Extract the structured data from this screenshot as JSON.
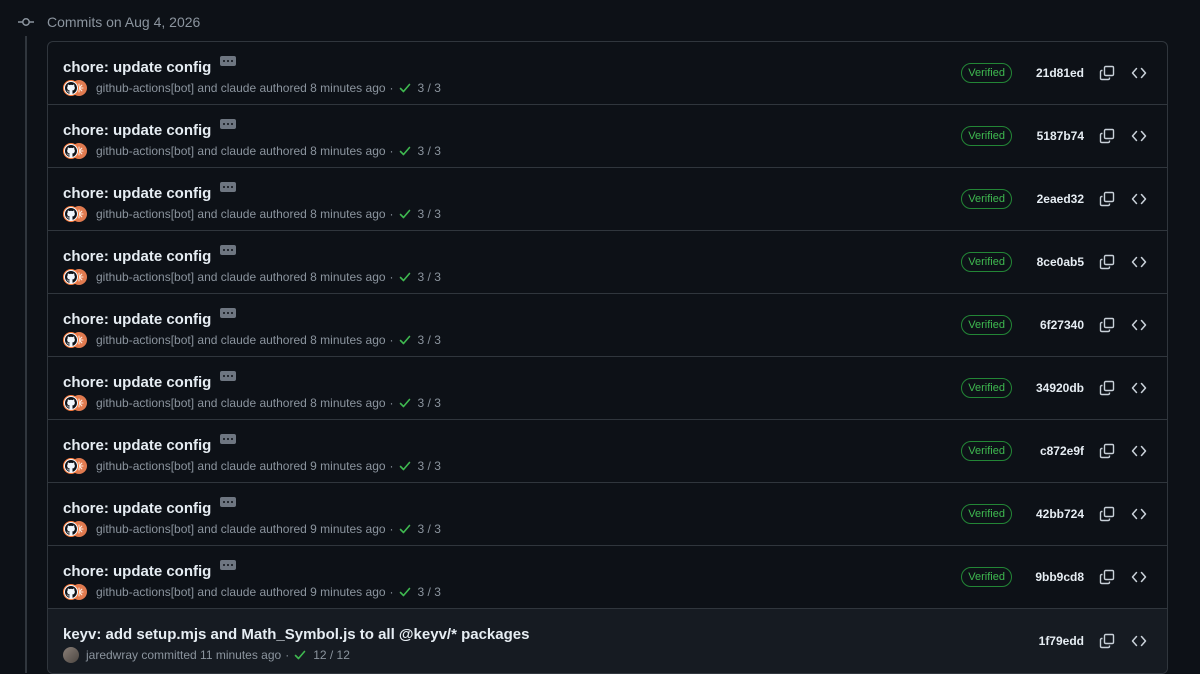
{
  "group": {
    "title": "Commits on Aug 4, 2026"
  },
  "commits": [
    {
      "title": "chore: update config",
      "authors": "github-actions[bot] and claude authored 8 minutes ago",
      "checks": "3 / 3",
      "verified": "Verified",
      "sha": "21d81ed"
    },
    {
      "title": "chore: update config",
      "authors": "github-actions[bot] and claude authored 8 minutes ago",
      "checks": "3 / 3",
      "verified": "Verified",
      "sha": "5187b74"
    },
    {
      "title": "chore: update config",
      "authors": "github-actions[bot] and claude authored 8 minutes ago",
      "checks": "3 / 3",
      "verified": "Verified",
      "sha": "2eaed32"
    },
    {
      "title": "chore: update config",
      "authors": "github-actions[bot] and claude authored 8 minutes ago",
      "checks": "3 / 3",
      "verified": "Verified",
      "sha": "8ce0ab5"
    },
    {
      "title": "chore: update config",
      "authors": "github-actions[bot] and claude authored 8 minutes ago",
      "checks": "3 / 3",
      "verified": "Verified",
      "sha": "6f27340"
    },
    {
      "title": "chore: update config",
      "authors": "github-actions[bot] and claude authored 8 minutes ago",
      "checks": "3 / 3",
      "verified": "Verified",
      "sha": "34920db"
    },
    {
      "title": "chore: update config",
      "authors": "github-actions[bot] and claude authored 9 minutes ago",
      "checks": "3 / 3",
      "verified": "Verified",
      "sha": "c872e9f"
    },
    {
      "title": "chore: update config",
      "authors": "github-actions[bot] and claude authored 9 minutes ago",
      "checks": "3 / 3",
      "verified": "Verified",
      "sha": "42bb724"
    },
    {
      "title": "chore: update config",
      "authors": "github-actions[bot] and claude authored 9 minutes ago",
      "checks": "3 / 3",
      "verified": "Verified",
      "sha": "9bb9cd8"
    },
    {
      "title": "keyv: add setup.mjs and Math_Symbol.js to all @keyv/* packages",
      "authors": "jaredwray committed 11 minutes ago",
      "checks": "12 / 12",
      "verified": "",
      "sha": "1f79edd"
    }
  ],
  "icons": {
    "commit": "git-commit-icon",
    "copy": "copy-icon",
    "browse": "code-brackets-icon",
    "check": "check-icon",
    "ellipsis": "ellipsis-icon"
  },
  "colors": {
    "background": "#0d1117",
    "border": "#30363d",
    "verified": "#3fb950",
    "muted": "#8b949e"
  }
}
